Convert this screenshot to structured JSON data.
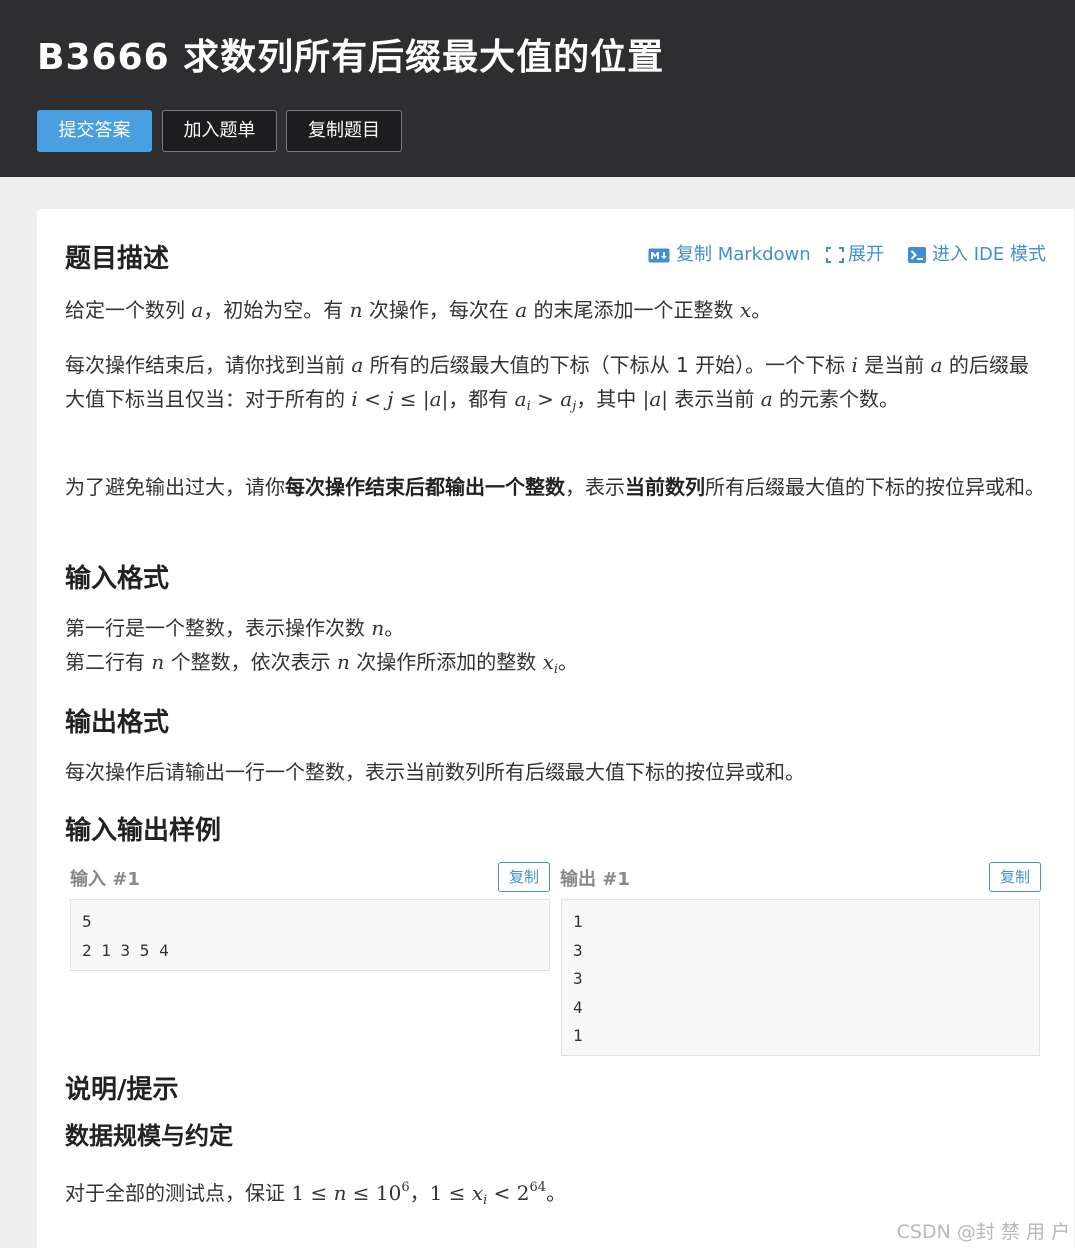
{
  "header": {
    "title": "B3666 求数列所有后缀最大值的位置",
    "buttons": {
      "submit": "提交答案",
      "add_list": "加入题单",
      "copy_problem": "复制题目"
    }
  },
  "toolbar": {
    "copy_markdown": "复制 Markdown",
    "expand": "展开",
    "ide_mode": "进入 IDE 模式"
  },
  "sections": {
    "description_title": "题目描述",
    "input_format_title": "输入格式",
    "output_format_title": "输出格式",
    "samples_title": "输入输出样例",
    "hint_title": "说明/提示",
    "constraints_title": "数据规模与约定"
  },
  "description": {
    "p1": {
      "a": "给定一个数列 ",
      "v1": "a",
      "b": "，初始为空。有 ",
      "v2": "n",
      "c": " 次操作，每次在 ",
      "v3": "a",
      "d": " 的末尾添加一个正整数 ",
      "v4": "x",
      "e": "。"
    },
    "p2": {
      "a": "每次操作结束后，请你找到当前 ",
      "v1": "a",
      "b": " 所有的后缀最大值的下标（下标从 1 开始）。一个下标 ",
      "v2": "i",
      "c": " 是当前 ",
      "v3": "a",
      "d": " 的后缀最大值下标当且仅当：对于所有的 ",
      "f1": "i < j ≤ |a|",
      "e": "，都有 ",
      "f2a": "a",
      "f2s": "i",
      "f2b": " > a",
      "f2t": "j",
      "f": "，其中 ",
      "f3": "|a|",
      "g": " 表示当前 ",
      "v4": "a",
      "h": " 的元素个数。"
    },
    "p3": {
      "a": "为了避免输出过大，请你",
      "b1": "每次操作结束后都输出一个整数",
      "b": "，表示",
      "b2": "当前数列",
      "c": "所有后缀最大值的下标的按位异或和。"
    }
  },
  "input_format": {
    "l1": {
      "a": "第一行是一个整数，表示操作次数 ",
      "v": "n",
      "b": "。"
    },
    "l2": {
      "a": "第二行有 ",
      "v1": "n",
      "b": " 个整数，依次表示 ",
      "v2": "n",
      "c": " 次操作所添加的整数 ",
      "v3": "x",
      "v3s": "i",
      "d": "。"
    }
  },
  "output_format": {
    "text": "每次操作后请输出一行一个整数，表示当前数列所有后缀最大值下标的按位异或和。"
  },
  "samples": {
    "input_label": "输入 #1",
    "output_label": "输出 #1",
    "copy_label": "复制",
    "input_lines": [
      "5",
      "2 1 3 5 4"
    ],
    "output_lines": [
      "1",
      "3",
      "3",
      "4",
      "1"
    ]
  },
  "constraints": {
    "a": "对于全部的测试点，保证 ",
    "f1a": "1 ≤ ",
    "f1v": "n",
    "f1b": " ≤ 10",
    "f1e": "6",
    "b": "，",
    "f2a": "1 ≤ ",
    "f2v": "x",
    "f2s": "i",
    "f2b": " < 2",
    "f2e": "64",
    "c": "。"
  },
  "watermark": "CSDN @封 禁 用 户",
  "colors": {
    "header_bg": "#2e2e30",
    "accent": "#4a9fe0",
    "link": "#3f8fd2",
    "page_bg": "#efefef"
  }
}
